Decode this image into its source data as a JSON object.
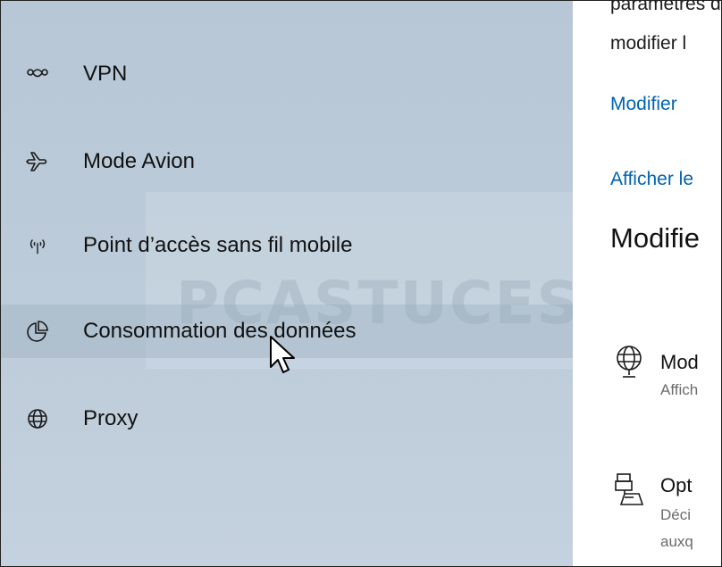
{
  "sidebar": {
    "items": [
      {
        "label": "VPN",
        "icon": "vpn-icon"
      },
      {
        "label": "Mode Avion",
        "icon": "airplane-icon"
      },
      {
        "label": "Point d’accès sans fil mobile",
        "icon": "hotspot-icon"
      },
      {
        "label": "Consommation des données",
        "icon": "data-usage-icon"
      },
      {
        "label": "Proxy",
        "icon": "globe-icon"
      }
    ],
    "watermark": "PCASTUCES"
  },
  "main": {
    "top_text_partial": "paramètres de",
    "top_text_line2": "modifier l",
    "link_1": "Modifier",
    "link_2": "Afficher le",
    "section_title": "Modifie",
    "settings": [
      {
        "title": "Mod",
        "desc": "Affich",
        "icon": "network-globe-icon"
      },
      {
        "title": "Opt",
        "desc": "Déci",
        "desc_line2": "auxq",
        "icon": "sharing-icon"
      }
    ]
  },
  "colors": {
    "sidebar_bg": "#bccbd9",
    "link": "#0063b1",
    "hover_row": "#a9b9c9"
  }
}
